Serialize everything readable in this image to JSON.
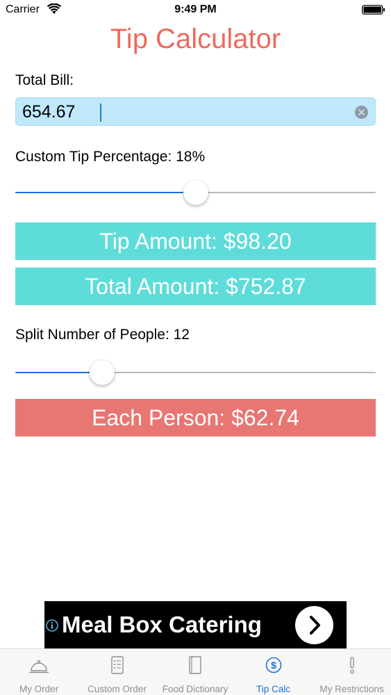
{
  "status_bar": {
    "carrier": "Carrier",
    "time": "9:49 PM"
  },
  "title": "Tip Calculator",
  "bill": {
    "label": "Total Bill:",
    "value": "654.67"
  },
  "tip": {
    "label": "Custom Tip Percentage: 18%",
    "slider_fraction": 0.5
  },
  "results": {
    "tip_amount": "Tip Amount: $98.20",
    "total_amount": "Total Amount: $752.87",
    "each_person": "Each Person: $62.74"
  },
  "split": {
    "label": "Split Number of People: 12",
    "slider_fraction": 0.24
  },
  "ad": {
    "text": "Meal Box Catering",
    "icon": "info-icon"
  },
  "tabs": [
    {
      "label": "My Order",
      "icon": "cloche-icon",
      "active": false
    },
    {
      "label": "Custom Order",
      "icon": "checklist-icon",
      "active": false
    },
    {
      "label": "Food Dictionary",
      "icon": "book-icon",
      "active": false
    },
    {
      "label": "Tip Calc",
      "icon": "dollar-circle-icon",
      "active": true
    },
    {
      "label": "My Restrictions",
      "icon": "exclamation-icon",
      "active": false
    }
  ],
  "colors": {
    "title": "#ec6a5e",
    "accent_blue": "#1a73d9",
    "result_teal": "#5edcd9",
    "each_person_red": "#e87672",
    "bill_field_bg": "#bfe8fb"
  }
}
